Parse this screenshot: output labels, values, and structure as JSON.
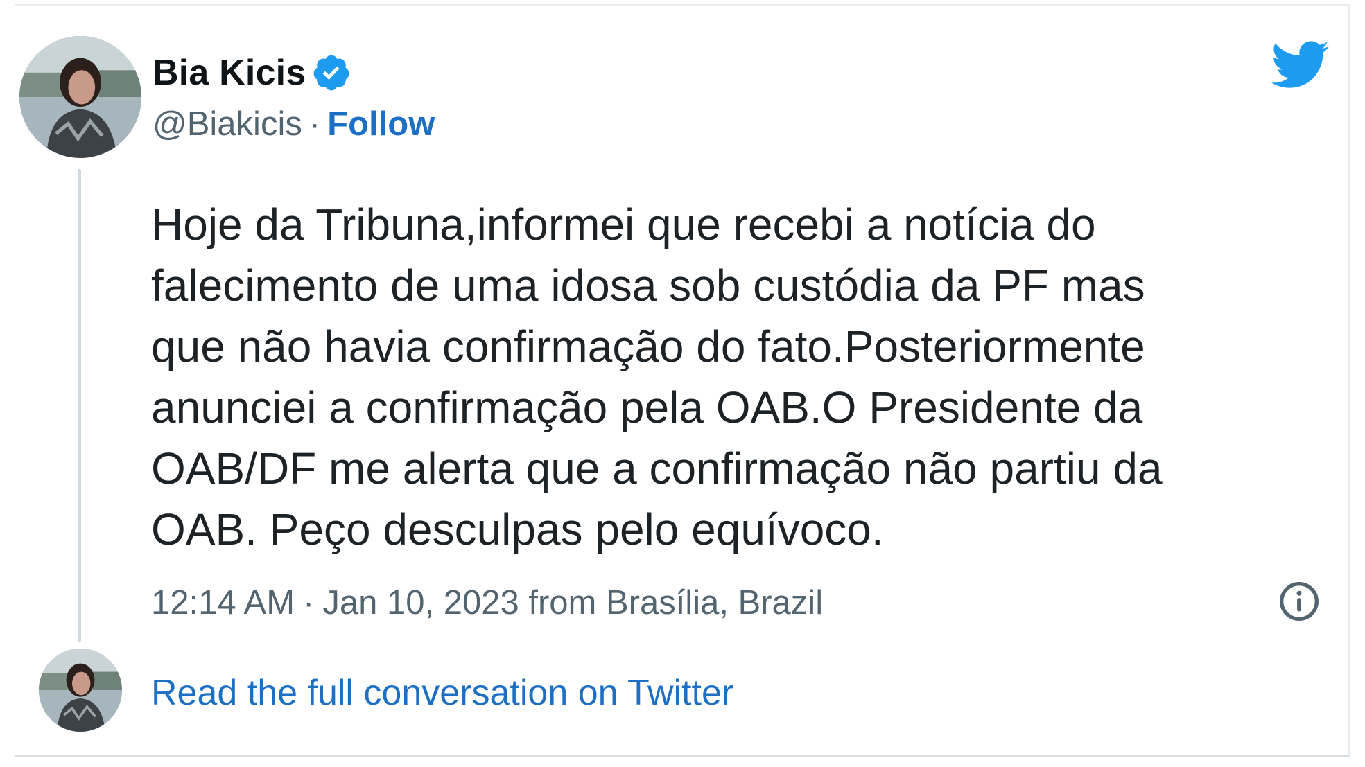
{
  "tweet": {
    "author": {
      "name": "Bia Kicis",
      "handle": "@Biakicis",
      "separator": "·",
      "follow_label": "Follow"
    },
    "text": "Hoje da Tribuna,informei que recebi a notícia do\nfalecimento de uma idosa sob custódia da PF mas\nque não havia confirmação do fato.Posteriormente\nanunciei a confirmação pela OAB.O Presidente da\nOAB/DF me alerta que a confirmação não partiu da\nOAB. Peço desculpas pelo equívoco.",
    "meta": {
      "time": "12:14 AM",
      "separator": "·",
      "date_location": "Jan 10, 2023 from Brasília, Brazil"
    },
    "read_full_label": "Read the full conversation on Twitter"
  },
  "icons": {
    "verified": "verified-badge-icon",
    "brand": "twitter-bird-icon",
    "info": "info-icon"
  },
  "colors": {
    "link_blue": "#1d6fc4",
    "verified_blue": "#1d9bf0",
    "muted_text": "#536471",
    "thread_line": "#cfd9de"
  }
}
